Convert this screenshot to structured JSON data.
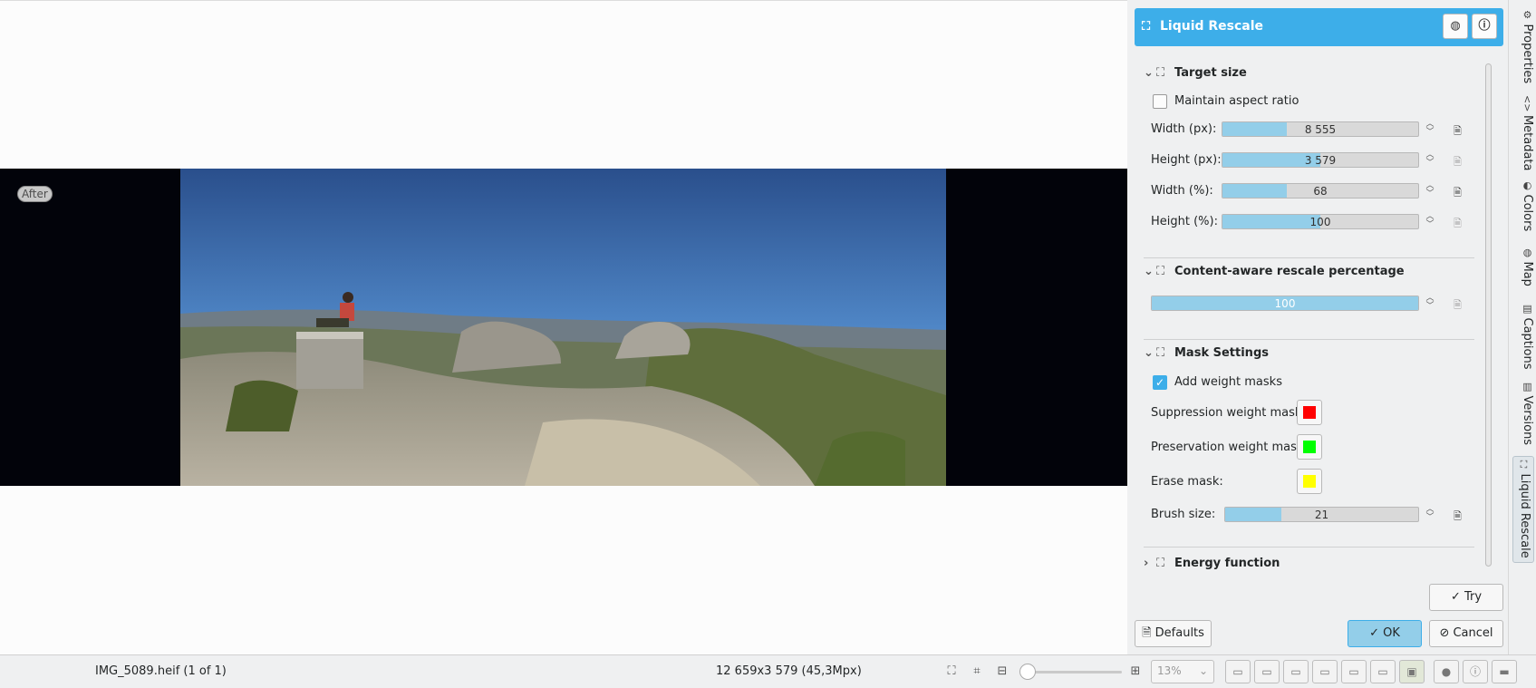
{
  "canvas": {
    "after_label": "After"
  },
  "status_bar": {
    "file": "IMG_5089.heif (1 of 1)",
    "image_size": "12 659x3 579 (45,3Mpx)",
    "zoom": "13%"
  },
  "tool": {
    "title": "Liquid Rescale",
    "target_size": {
      "title": "Target size",
      "maintain_aspect_ratio": {
        "label": "Maintain aspect ratio",
        "checked": false
      },
      "width_px": {
        "label": "Width (px):",
        "value": "8 555",
        "fraction": 0.33
      },
      "height_px": {
        "label": "Height (px):",
        "value": "3 579",
        "fraction": 0.5
      },
      "width_pct": {
        "label": "Width (%):",
        "value": "68",
        "fraction": 0.33
      },
      "height_pct": {
        "label": "Height (%):",
        "value": "100",
        "fraction": 0.5
      }
    },
    "content_aware": {
      "title": "Content-aware rescale percentage",
      "value": "100",
      "fraction": 1.0
    },
    "mask_settings": {
      "title": "Mask Settings",
      "add_weight_masks": {
        "label": "Add weight masks",
        "checked": true
      },
      "suppression": {
        "label": "Suppression weight mask:",
        "color": "#ff0000"
      },
      "preservation": {
        "label": "Preservation weight mask:",
        "color": "#00ff00"
      },
      "erase": {
        "label": "Erase mask:",
        "color": "#ffff00"
      },
      "brush_size": {
        "label": "Brush size:",
        "value": "21",
        "fraction": 0.29
      }
    },
    "energy_function": {
      "title": "Energy function"
    },
    "buttons": {
      "try": "Try",
      "defaults": "Defaults",
      "ok": "OK",
      "cancel": "Cancel"
    }
  },
  "side_tabs": [
    "Properties",
    "Metadata",
    "Colors",
    "Map",
    "Captions",
    "Versions",
    "Liquid Rescale"
  ],
  "colors": {
    "accent": "#3daee9",
    "slider_fill": "#93cee9"
  }
}
